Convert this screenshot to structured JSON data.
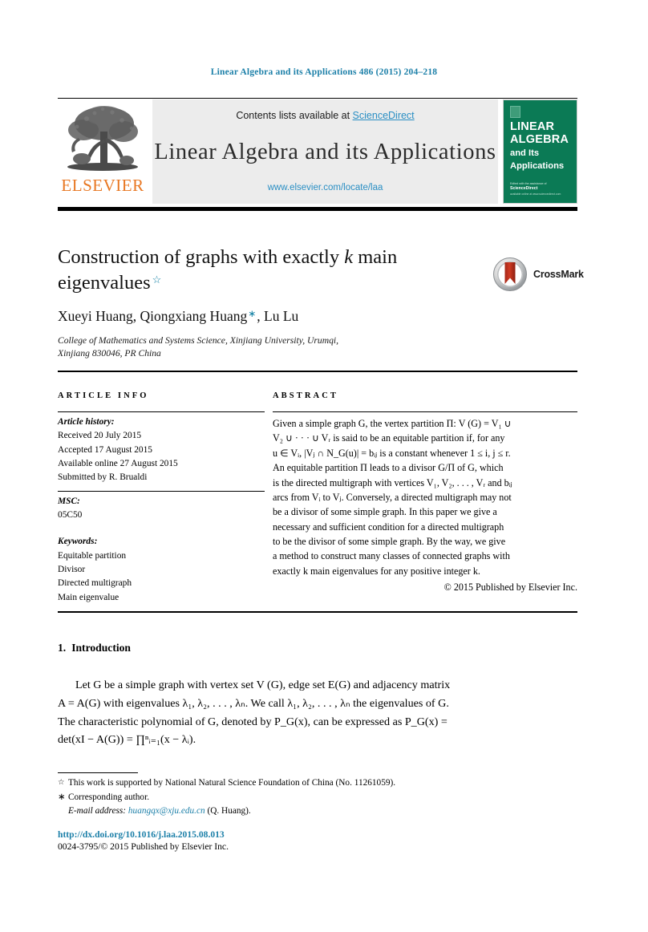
{
  "running_head": "Linear Algebra and its Applications 486 (2015) 204–218",
  "masthead": {
    "contents_prefix": "Contents lists available at ",
    "sciencedirect": "ScienceDirect",
    "journal_name": "Linear Algebra and its Applications",
    "journal_url": "www.elsevier.com/locate/laa",
    "publisher_logo_text": "ELSEVIER",
    "cover": {
      "line1": "LINEAR",
      "line2": "ALGEBRA",
      "line3": "and Its",
      "line4": "Applications",
      "foot_small": "Edited with the assistance of",
      "foot_brand": "ScienceDirect",
      "foot_tiny": "available online at www.sciencedirect.com"
    },
    "accent_link_color": "#2b8fc4",
    "cover_bg_color": "#0b7a55",
    "elsevier_orange": "#e87722"
  },
  "article": {
    "title_part1": "Construction of graphs with exactly ",
    "title_k": "k",
    "title_part2": " main",
    "title_part3": "eigenvalues",
    "title_footnote_mark": "☆",
    "authors_part1": "Xueyi Huang, Qiongxiang Huang",
    "authors_corr_mark": "∗",
    "authors_part2": ", Lu Lu",
    "affiliation_line1": "College of Mathematics and Systems Science, Xinjiang University, Urumqi,",
    "affiliation_line2": "Xinjiang 830046, PR China",
    "crossmark_label": "CrossMark"
  },
  "info": {
    "heading": "ARTICLE INFO",
    "history_label": "Article history:",
    "history": [
      "Received 20 July 2015",
      "Accepted 17 August 2015",
      "Available online 27 August 2015",
      "Submitted by R. Brualdi"
    ],
    "msc_label": "MSC:",
    "msc_value": "05C50",
    "keywords_label": "Keywords:",
    "keywords": [
      "Equitable partition",
      "Divisor",
      "Directed multigraph",
      "Main eigenvalue"
    ]
  },
  "abstract": {
    "heading": "ABSTRACT",
    "lines": [
      "Given a simple graph G, the vertex partition Π: V (G) = V₁ ∪",
      "V₂ ∪ · · · ∪ Vᵣ is said to be an equitable partition if, for any",
      "u ∈ Vᵢ, |Vⱼ ∩ N_G(u)| = bᵢⱼ is a constant whenever 1 ≤ i, j ≤ r.",
      "An equitable partition Π leads to a divisor G/Π of G, which",
      "is the directed multigraph with vertices V₁, V₂, . . . , Vᵣ and bᵢⱼ",
      "arcs from Vᵢ to Vⱼ. Conversely, a directed multigraph may not",
      "be a divisor of some simple graph. In this paper we give a",
      "necessary and sufficient condition for a directed multigraph",
      "to be the divisor of some simple graph. By the way, we give",
      "a method to construct many classes of connected graphs with",
      "exactly k main eigenvalues for any positive integer k."
    ],
    "copyright": "© 2015 Published by Elsevier Inc."
  },
  "body": {
    "section_number": "1.",
    "section_title": "Introduction",
    "paragraph_lines": [
      "Let G be a simple graph with vertex set V (G), edge set E(G) and adjacency matrix",
      "A = A(G) with eigenvalues λ₁, λ₂, . . . , λₙ. We call λ₁, λ₂, . . . , λₙ the eigenvalues of G.",
      "The characteristic polynomial of G, denoted by P_G(x), can be expressed as P_G(x) =",
      "det(xI − A(G)) = ∏ⁿᵢ₌₁(x − λᵢ)."
    ]
  },
  "footnotes": {
    "star_symbol": "☆",
    "star_text": "This work is supported by National Natural Science Foundation of China (No. 11261059).",
    "corr_symbol": "∗",
    "corr_text": "Corresponding author.",
    "email_label": "E-mail address:",
    "email_address": "huangqx@xju.edu.cn",
    "email_owner": "(Q. Huang).",
    "doi": "http://dx.doi.org/10.1016/j.laa.2015.08.013",
    "issn_copyright": "0024-3795/© 2015 Published by Elsevier Inc.",
    "link_color": "#1b7fa8"
  }
}
